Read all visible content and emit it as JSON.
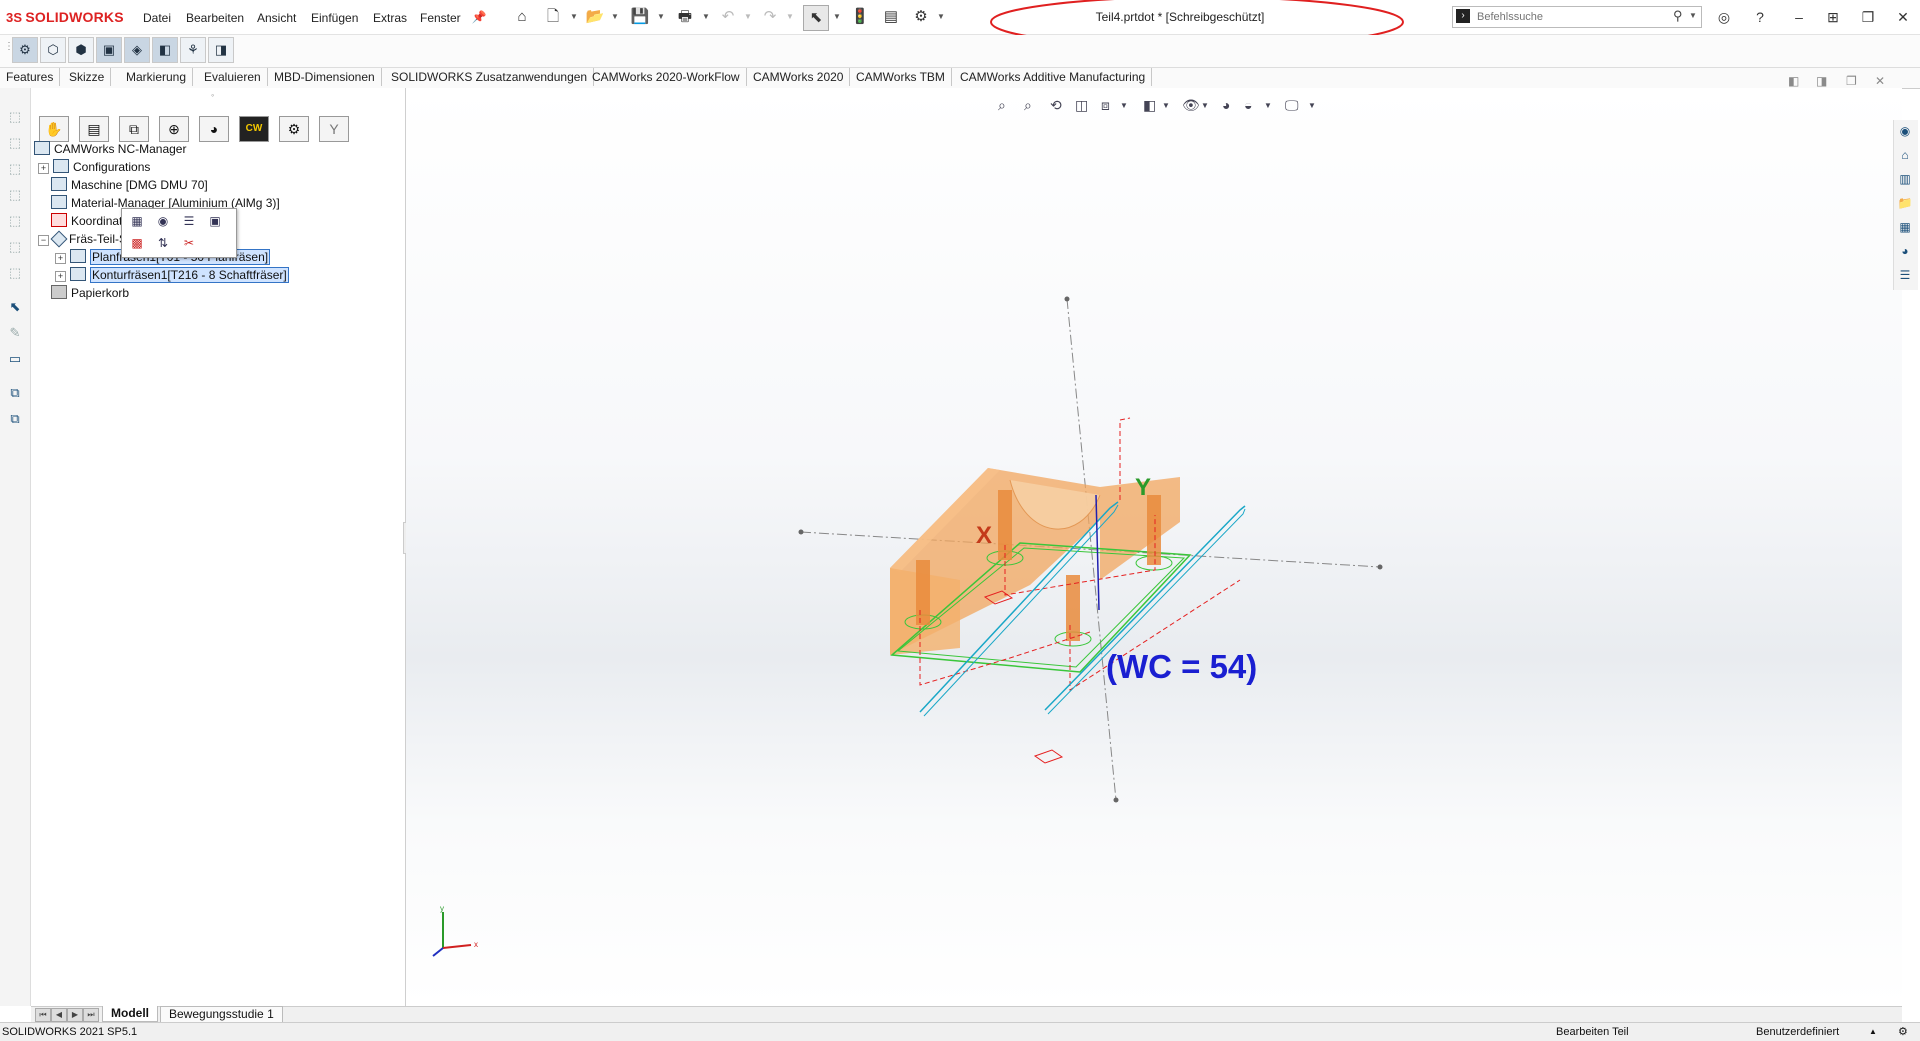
{
  "app": {
    "name": "SOLIDWORKS",
    "logo_prefix": "3S"
  },
  "menu": [
    "Datei",
    "Bearbeiten",
    "Ansicht",
    "Einfügen",
    "Extras",
    "Fenster"
  ],
  "document_title": "Teil4.prtdot * [Schreibgeschützt]",
  "search": {
    "placeholder": "Befehlssuche"
  },
  "tabs": [
    "Features",
    "Skizze",
    "Markierung",
    "Evaluieren",
    "MBD-Dimensionen",
    "SOLIDWORKS Zusatzanwendungen",
    "CAMWorks 2020-WorkFlow",
    "CAMWorks 2020",
    "CAMWorks TBM",
    "CAMWorks Additive Manufacturing"
  ],
  "tree": {
    "root": "CAMWorks NC-Manager",
    "items": [
      {
        "label": "Configurations"
      },
      {
        "label": "Maschine [DMG DMU 70]"
      },
      {
        "label": "Material-Manager [Aluminium (AlMg 3)]",
        "shown": "Material-Manager [Aluminium (AlMg 3)]"
      },
      {
        "label": "Koordinatensystem"
      },
      {
        "label": "Fräs-Teil-Setup1 [Gruppe1]"
      },
      {
        "label": "Planfräsen1[T01 - 50 Planfräsen]"
      },
      {
        "label": "Konturfräsen1[T216 - 8 Schaftfräser]"
      },
      {
        "label": "Papierkorb"
      }
    ]
  },
  "viewport": {
    "annotation": "(WC = 54)",
    "axis_x": "X",
    "axis_y": "Y",
    "triad_x": "x",
    "triad_y": "y",
    "annotation_color": "#1a1fd1",
    "part_color": "#f2a55e"
  },
  "bottom_tabs": [
    "Modell",
    "Bewegungsstudie 1"
  ],
  "status": {
    "version": "SOLIDWORKS 2021 SP5.1",
    "mode": "Bearbeiten Teil",
    "units": "Benutzerdefiniert"
  }
}
